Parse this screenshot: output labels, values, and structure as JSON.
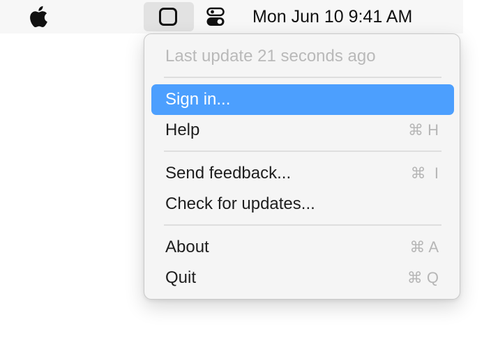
{
  "menubar": {
    "clock": "Mon Jun 10  9:41 AM"
  },
  "menu": {
    "status": "Last update 21 seconds ago",
    "items": [
      {
        "label": "Sign in...",
        "shortcut": ""
      },
      {
        "label": "Help",
        "shortcut": "⌘ H"
      },
      {
        "label": "Send feedback...",
        "shortcut": "⌘  I"
      },
      {
        "label": "Check for updates...",
        "shortcut": ""
      },
      {
        "label": "About",
        "shortcut": "⌘ A"
      },
      {
        "label": "Quit",
        "shortcut": "⌘ Q"
      }
    ]
  },
  "colors": {
    "highlight": "#4c9ffe",
    "menu_background": "#f5f5f5",
    "menubar_background": "#f7f7f7"
  },
  "icons": [
    "apple-logo-icon",
    "app-status-icon",
    "control-center-icon"
  ]
}
